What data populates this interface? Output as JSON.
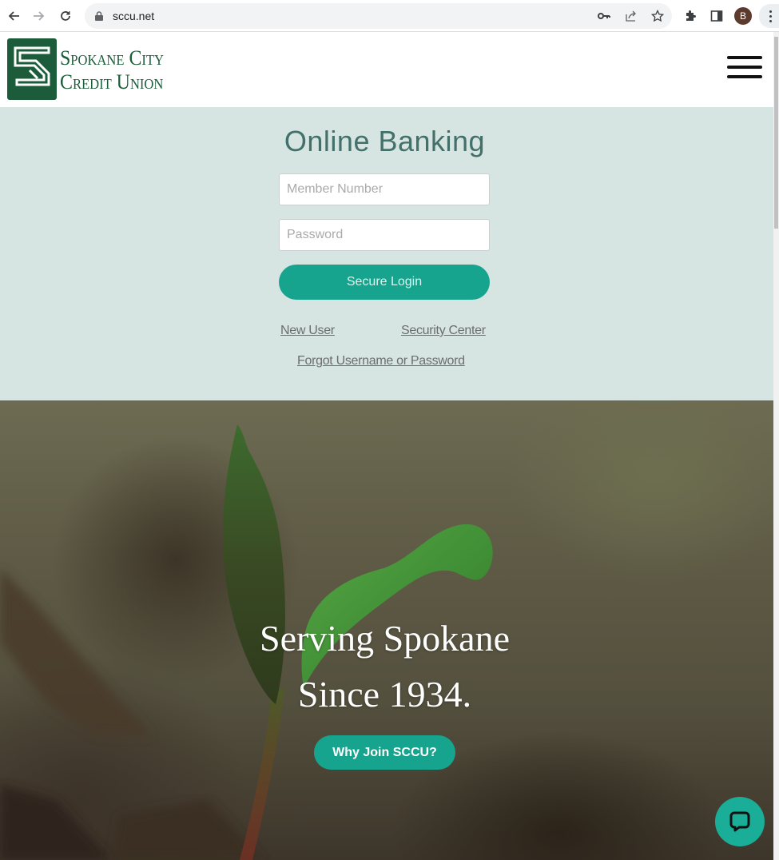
{
  "browser": {
    "url": "sccu.net",
    "profile_initial": "B",
    "icons": [
      "back-arrow-icon",
      "forward-arrow-icon",
      "reload-icon",
      "lock-icon",
      "key-icon",
      "share-icon",
      "star-icon",
      "extensions-puzzle-icon",
      "side-panel-icon",
      "profile-avatar",
      "more-vert-icon"
    ]
  },
  "header": {
    "logo_line1": "Spokane City",
    "logo_line2": "Credit Union",
    "menu_icon": "hamburger-menu-icon"
  },
  "login": {
    "title": "Online Banking",
    "member_placeholder": "Member Number",
    "member_value": "",
    "password_placeholder": "Password",
    "password_value": "",
    "submit_label": "Secure Login",
    "links": {
      "new_user": "New User",
      "security_center": "Security Center",
      "forgot": "Forgot Username or Password"
    }
  },
  "hero": {
    "title_line1": "Serving Spokane",
    "title_line2": "Since 1934.",
    "cta_label": "Why Join SCCU?",
    "chat_icon": "chat-bubble-icon"
  },
  "colors": {
    "brand_green": "#1c5c3a",
    "accent_teal": "#16a48f",
    "login_bg": "#d6e5e1",
    "title_color": "#43706a"
  }
}
